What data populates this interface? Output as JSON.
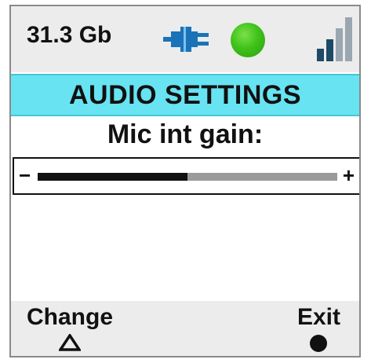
{
  "status_bar": {
    "storage": "31.3 Gb",
    "power_icon": "plug-icon",
    "status_color": "#3fc21a",
    "signal_icon": "signal-bars-icon"
  },
  "header": {
    "title": "AUDIO SETTINGS"
  },
  "setting": {
    "label": "Mic int gain:",
    "minus_label": "−",
    "plus_label": "+",
    "level_fraction": 0.5
  },
  "softkeys": {
    "left": {
      "label": "Change",
      "icon": "triangle-up-icon"
    },
    "right": {
      "label": "Exit",
      "icon": "filled-circle-icon"
    }
  },
  "colors": {
    "accent": "#67e3f2",
    "plug": "#1a73b8"
  }
}
